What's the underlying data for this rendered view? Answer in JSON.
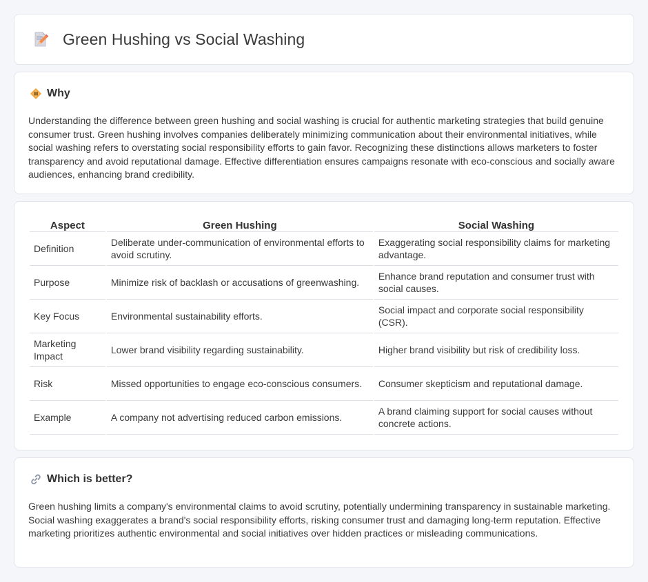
{
  "header": {
    "title": "Green Hushing vs Social Washing",
    "icon": "document-pencil-icon"
  },
  "why": {
    "heading": "Why",
    "icon": "warning-diamond-icon",
    "text": "Understanding the difference between green hushing and social washing is crucial for authentic marketing strategies that build genuine consumer trust. Green hushing involves companies deliberately minimizing communication about their environmental initiatives, while social washing refers to overstating social responsibility efforts to gain favor. Recognizing these distinctions allows marketers to foster transparency and avoid reputational damage. Effective differentiation ensures campaigns resonate with eco-conscious and socially aware audiences, enhancing brand credibility."
  },
  "comparison": {
    "headers": [
      "Aspect",
      "Green Hushing",
      "Social Washing"
    ],
    "rows": [
      [
        "Definition",
        "Deliberate under-communication of environmental efforts to avoid scrutiny.",
        "Exaggerating social responsibility claims for marketing advantage."
      ],
      [
        "Purpose",
        "Minimize risk of backlash or accusations of greenwashing.",
        "Enhance brand reputation and consumer trust with social causes."
      ],
      [
        "Key Focus",
        "Environmental sustainability efforts.",
        "Social impact and corporate social responsibility (CSR)."
      ],
      [
        "Marketing Impact",
        "Lower brand visibility regarding sustainability.",
        "Higher brand visibility but risk of credibility loss."
      ],
      [
        "Risk",
        "Missed opportunities to engage eco-conscious consumers.",
        "Consumer skepticism and reputational damage."
      ],
      [
        "Example",
        "A company not advertising reduced carbon emissions.",
        "A brand claiming support for social causes without concrete actions."
      ]
    ]
  },
  "better": {
    "heading": "Which is better?",
    "icon": "link-icon",
    "text": "Green hushing limits a company's environmental claims to avoid scrutiny, potentially undermining transparency in sustainable marketing. Social washing exaggerates a brand's social responsibility efforts, risking consumer trust and damaging long-term reputation. Effective marketing prioritizes authentic environmental and social initiatives over hidden practices or misleading communications."
  },
  "colors": {
    "background": "#f5f6fa",
    "card": "#ffffff",
    "border": "#e3e5ec",
    "text": "#3b3b3b",
    "accent": "#f2a33a"
  }
}
